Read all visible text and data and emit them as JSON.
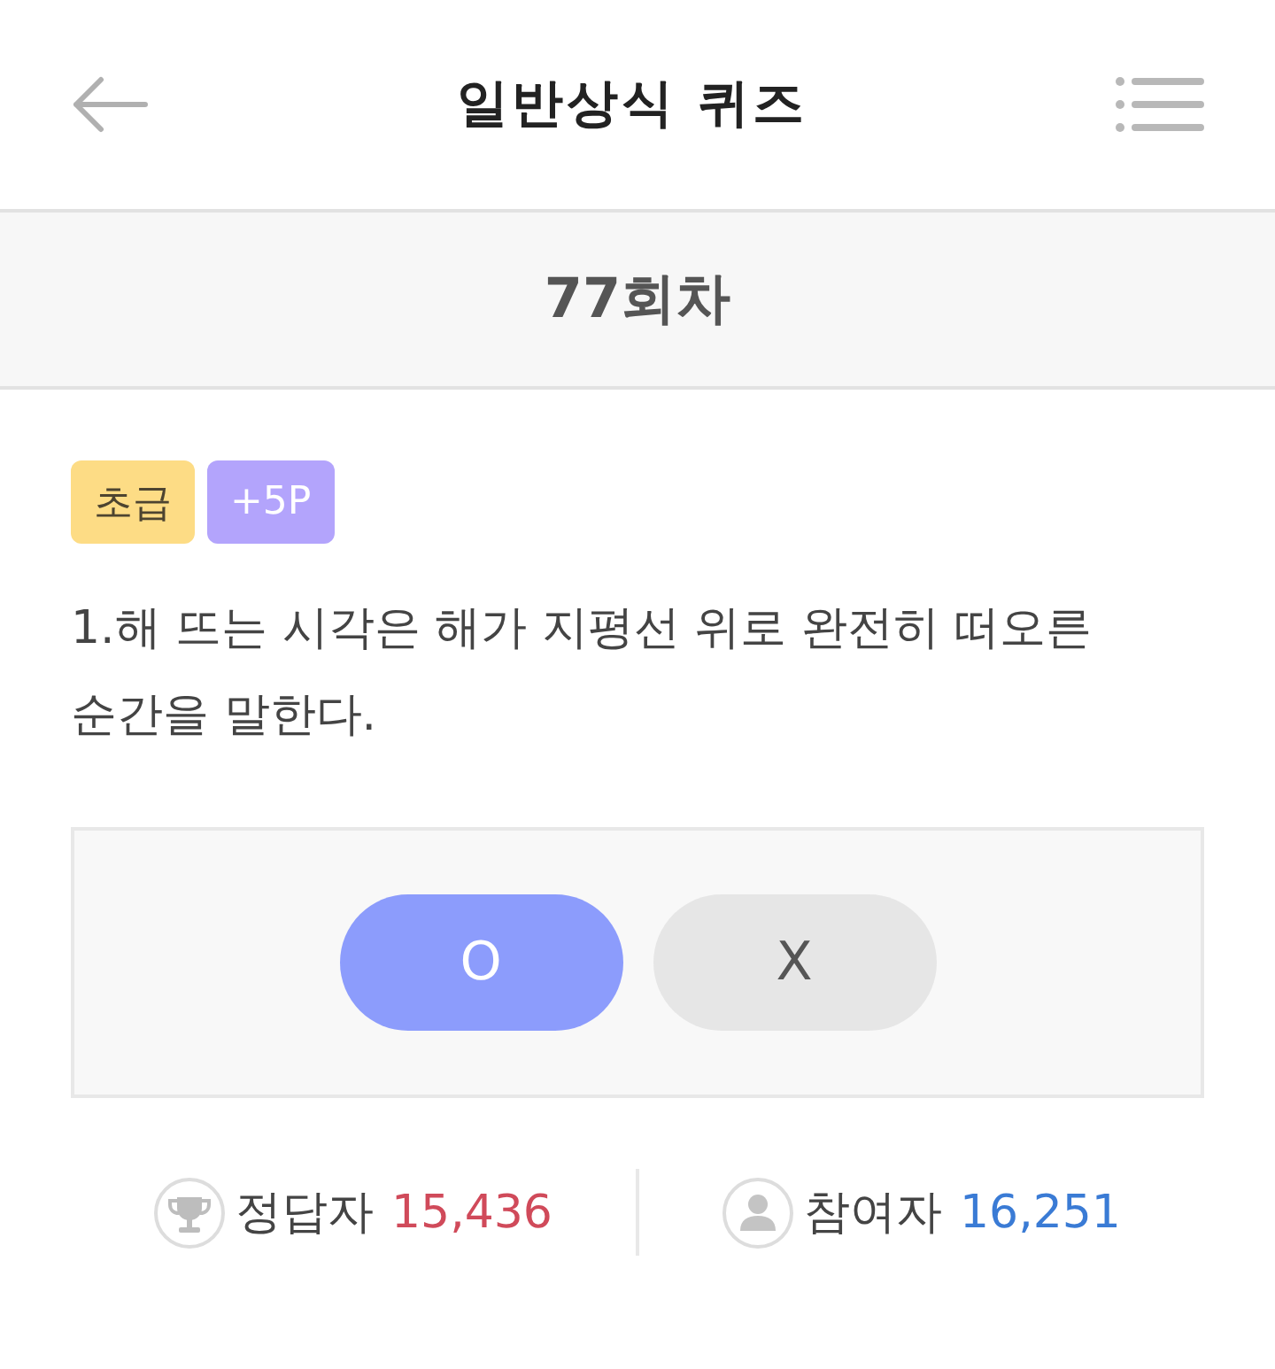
{
  "header": {
    "title": "일반상식 퀴즈"
  },
  "round": {
    "title": "77회차"
  },
  "badges": [
    {
      "label": "초급",
      "kind": "level"
    },
    {
      "label": "+5P",
      "kind": "points"
    }
  ],
  "question": {
    "text": "1.해 뜨는 시각은 해가 지평선 위로 완전히 떠오른 순간을 말한다."
  },
  "answers": [
    {
      "label": "O",
      "selected": true
    },
    {
      "label": "X",
      "selected": false
    }
  ],
  "stats": [
    {
      "kind": "trophy",
      "label": "정답자",
      "value": "15,436",
      "color": "#d04a5a"
    },
    {
      "kind": "person",
      "label": "참여자",
      "value": "16,251",
      "color": "#3a7bd5"
    }
  ]
}
